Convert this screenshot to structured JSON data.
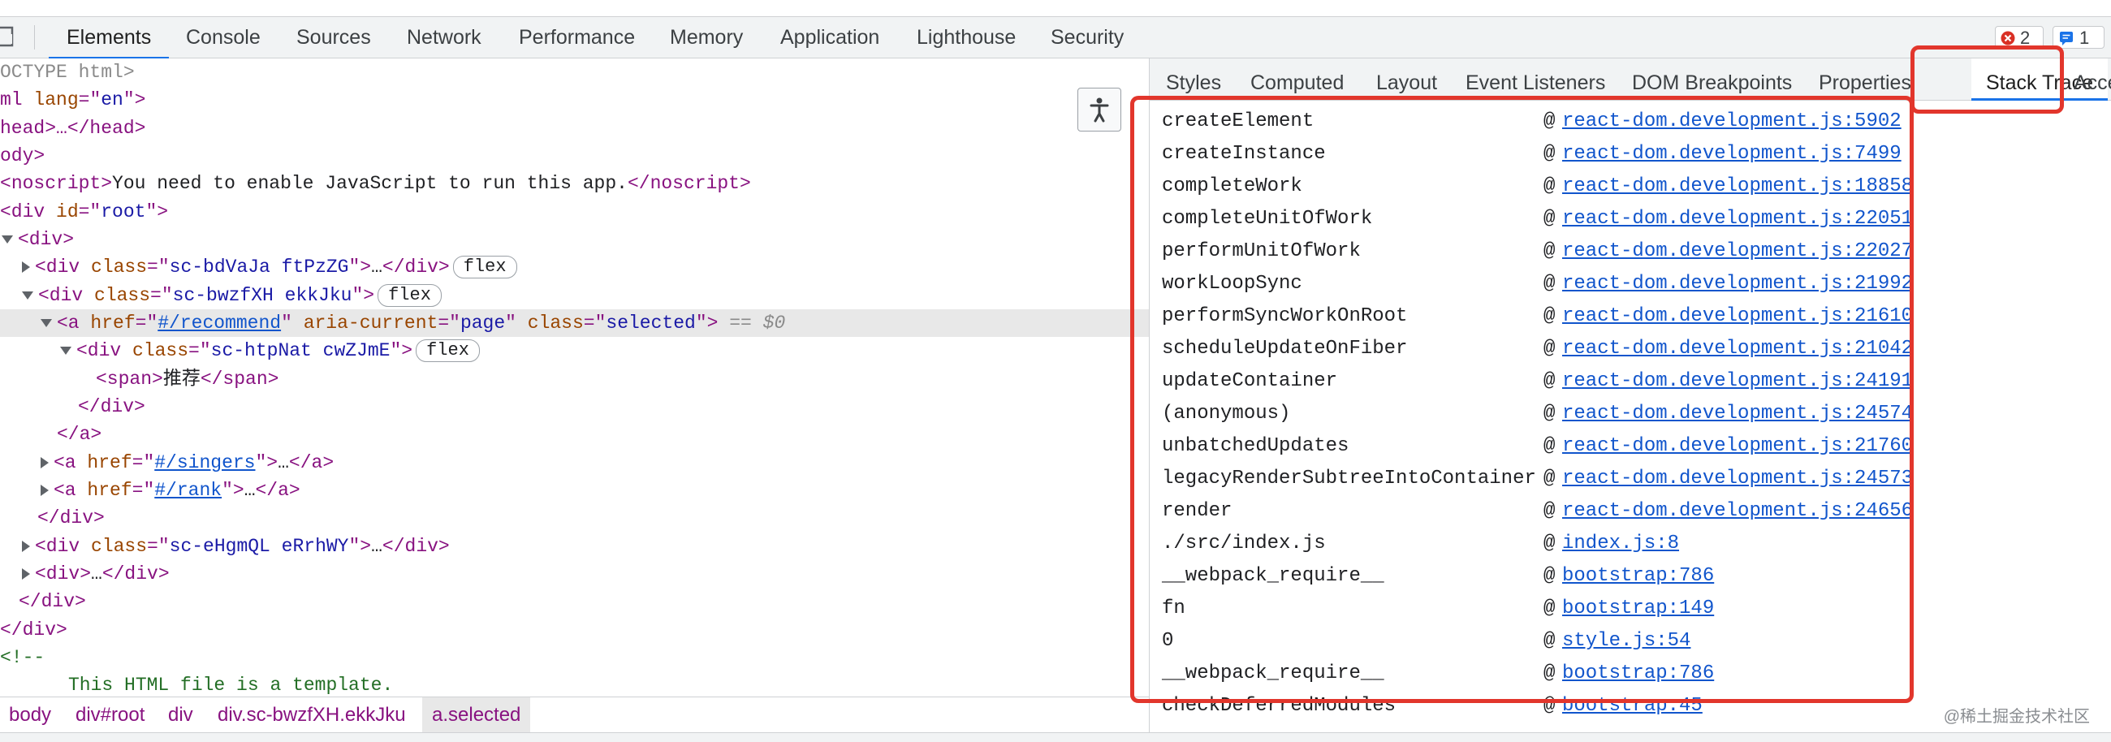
{
  "top_tabs": [
    "Elements",
    "Console",
    "Sources",
    "Network",
    "Performance",
    "Memory",
    "Application",
    "Lighthouse",
    "Security"
  ],
  "top_badges": {
    "errors": "2",
    "messages": "1"
  },
  "colors": {
    "accent": "#1a73e8",
    "highlight": "#e2362c",
    "error": "#d93025"
  },
  "tree": {
    "doctype": "OCTYPE html>",
    "html_open_a": "ml",
    "html_attr": "lang",
    "html_val": "en",
    "head": "head>…</head>",
    "body": "ody>",
    "noscript_tag": "noscript",
    "noscript_text": "You need to enable JavaScript to run this app.",
    "root_id": "root",
    "class1": "sc-bdVaJa ftPzZG",
    "class2": "sc-bwzfXH ekkJku",
    "href1": "#/recommend",
    "aria_val": "page",
    "class_sel": "selected",
    "dollar": "$0",
    "class3": "sc-htpNat cwZJmE",
    "span_text": "推荐",
    "href2": "#/singers",
    "href3": "#/rank",
    "class4": "sc-eHgmQL eRrhWY",
    "comment_open": "<!--",
    "comment_text": "This HTML file is a template.",
    "flex_label": "flex",
    "ellipsis": "…"
  },
  "breadcrumb": [
    "body",
    "div#root",
    "div",
    "div.sc-bwzfXH.ekkJku",
    "a.selected"
  ],
  "sidebar_tabs": [
    "Styles",
    "Computed",
    "Layout",
    "Event Listeners",
    "DOM Breakpoints",
    "Properties",
    "Stack Trace",
    "Acce"
  ],
  "stack_trace": [
    {
      "fn": "createElement",
      "loc": "react-dom.development.js:5902"
    },
    {
      "fn": "createInstance",
      "loc": "react-dom.development.js:7499"
    },
    {
      "fn": "completeWork",
      "loc": "react-dom.development.js:18858"
    },
    {
      "fn": "completeUnitOfWork",
      "loc": "react-dom.development.js:22051"
    },
    {
      "fn": "performUnitOfWork",
      "loc": "react-dom.development.js:22027"
    },
    {
      "fn": "workLoopSync",
      "loc": "react-dom.development.js:21992"
    },
    {
      "fn": "performSyncWorkOnRoot",
      "loc": "react-dom.development.js:21610"
    },
    {
      "fn": "scheduleUpdateOnFiber",
      "loc": "react-dom.development.js:21042"
    },
    {
      "fn": "updateContainer",
      "loc": "react-dom.development.js:24191"
    },
    {
      "fn": "(anonymous)",
      "loc": "react-dom.development.js:24574"
    },
    {
      "fn": "unbatchedUpdates",
      "loc": "react-dom.development.js:21760"
    },
    {
      "fn": "legacyRenderSubtreeIntoContainer",
      "loc": "react-dom.development.js:24573"
    },
    {
      "fn": "render",
      "loc": "react-dom.development.js:24656"
    },
    {
      "fn": "./src/index.js",
      "loc": "index.js:8"
    },
    {
      "fn": "__webpack_require__",
      "loc": "bootstrap:786"
    },
    {
      "fn": "fn",
      "loc": "bootstrap:149"
    },
    {
      "fn": "0",
      "loc": "style.js:54"
    },
    {
      "fn": "__webpack_require__",
      "loc": "bootstrap:786"
    },
    {
      "fn": "checkDeferredModules",
      "loc": "bootstrap:45"
    }
  ],
  "at_symbol": "@",
  "watermark": "@稀土掘金技术社区"
}
